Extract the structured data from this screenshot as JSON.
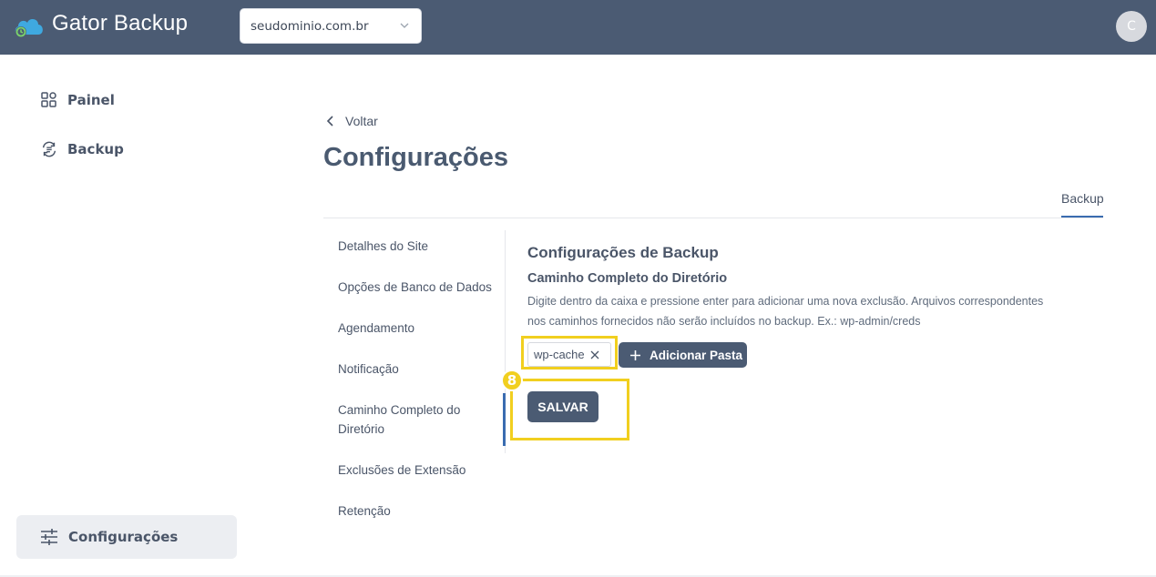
{
  "app": {
    "brand": "Gator Backup",
    "avatar_initial": "C"
  },
  "domain_select": {
    "value": "seudominio.com.br"
  },
  "sidebar": {
    "items": [
      {
        "label": "Painel",
        "icon": "dashboard-icon"
      },
      {
        "label": "Backup",
        "icon": "backup-sync-icon"
      }
    ],
    "bottom": {
      "label": "Configurações",
      "icon": "sliders-icon"
    }
  },
  "page": {
    "back_label": "Voltar",
    "title": "Configurações",
    "tab": "Backup"
  },
  "settings_menu": [
    "Detalhes do Site",
    "Opções de Banco de Dados",
    "Agendamento",
    "Notificação",
    "Caminho Completo do Diretório",
    "Exclusões de Extensão",
    "Retenção"
  ],
  "section": {
    "title": "Configurações de Backup",
    "subtitle": "Caminho Completo do Diretório",
    "description_line1": "Digite dentro da caixa e pressione enter para adicionar uma nova exclusão. Arquivos correspondentes",
    "description_line2": "nos caminhos fornecidos não serão incluídos no backup. Ex.: wp-admin/creds",
    "chip": "wp-cache",
    "add_button": "Adicionar Pasta",
    "save_button": "SALVAR",
    "step_badge": "8"
  },
  "colors": {
    "topbar": "#4b5b73",
    "accent": "#3a6cb0",
    "highlight": "#f1cf1f"
  }
}
